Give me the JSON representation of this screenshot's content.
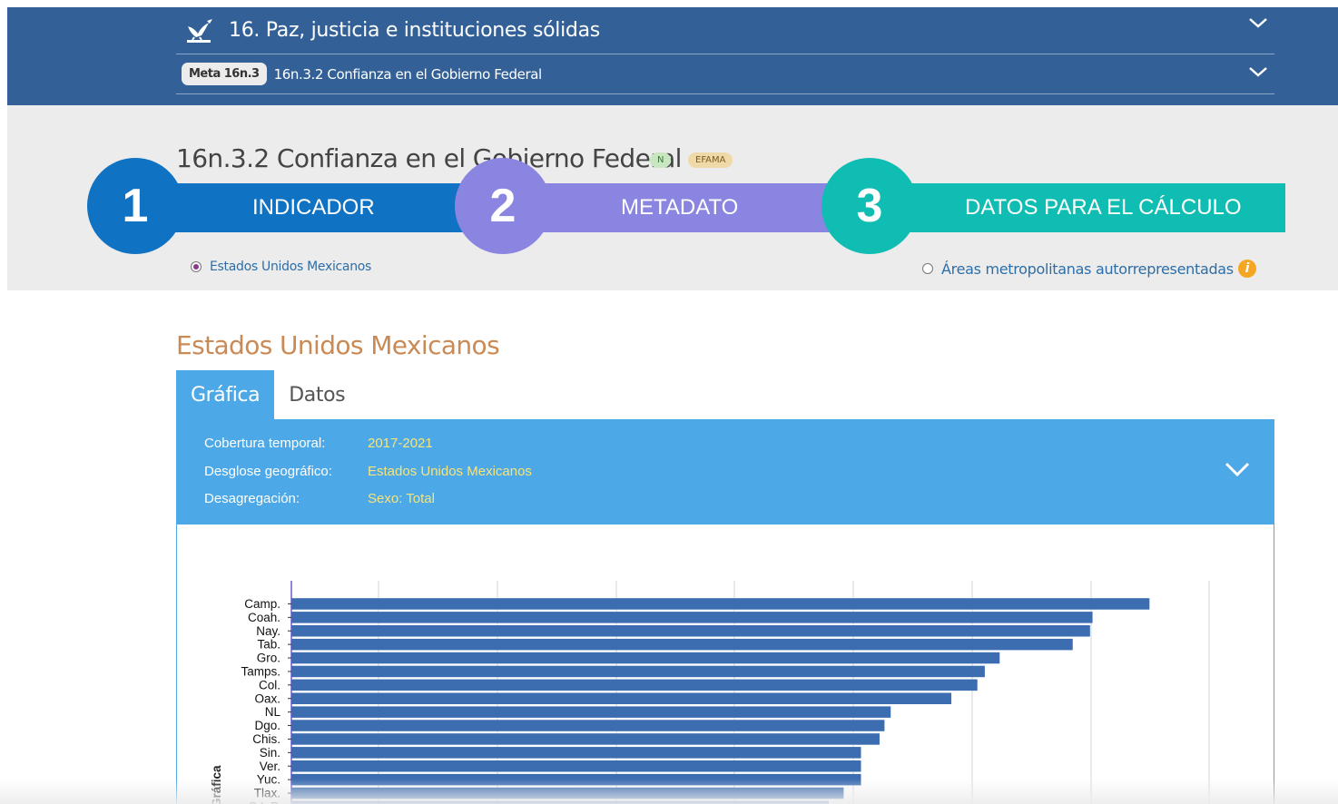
{
  "header": {
    "goal_title": "16. Paz, justicia e instituciones sólidas",
    "meta_pill": "Meta 16n.3",
    "meta_text": "16n.3.2  Confianza en el Gobierno Federal"
  },
  "indicator": {
    "title": "16n.3.2  Confianza en el Gobierno Federal",
    "badge_n": "N",
    "badge_e": "EFAMA",
    "steps": [
      {
        "number": "1",
        "label": "INDICADOR"
      },
      {
        "number": "2",
        "label": "METADATO"
      },
      {
        "number": "3",
        "label": "DATOS PARA EL CÁLCULO"
      }
    ],
    "radio_national": "Estados Unidos Mexicanos",
    "radio_metro": "Áreas metropolitanas autorrepresentadas"
  },
  "section": {
    "title": "Estados Unidos Mexicanos",
    "tabs": [
      "Gráfica",
      "Datos"
    ]
  },
  "filters": {
    "cobertura_label": "Cobertura temporal:",
    "cobertura_value": "2017-2021",
    "desglose_label": "Desglose geográfico:",
    "desglose_value": "Estados Unidos Mexicanos",
    "desagregacion_label": "Desagregación:",
    "desagregacion_value": "Sexo: Total"
  },
  "colors": {
    "header_blue": "#336197",
    "step1": "#0f72c3",
    "step2": "#8a85e0",
    "step3": "#10bdb2",
    "panel_blue": "#4ca8e6",
    "bar_blue": "#3b6db0",
    "filter_value": "#f8e47a"
  },
  "chart_data": {
    "type": "bar",
    "orientation": "horizontal",
    "ylabel": "Gráfica",
    "categories": [
      "Camp.",
      "Coah.",
      "Nay.",
      "Tab.",
      "Gro.",
      "Tamps.",
      "Col.",
      "Oax.",
      "NL",
      "Dgo.",
      "Chis.",
      "Sin.",
      "Ver.",
      "Yuc.",
      "Tlax.",
      "S.L.P."
    ],
    "values": [
      69.3,
      64.7,
      64.5,
      63.1,
      57.2,
      56.0,
      55.4,
      53.3,
      48.4,
      47.9,
      47.5,
      46.0,
      46.0,
      46.0,
      44.6,
      43.4
    ],
    "xlim": [
      0,
      78
    ],
    "grid": true
  }
}
